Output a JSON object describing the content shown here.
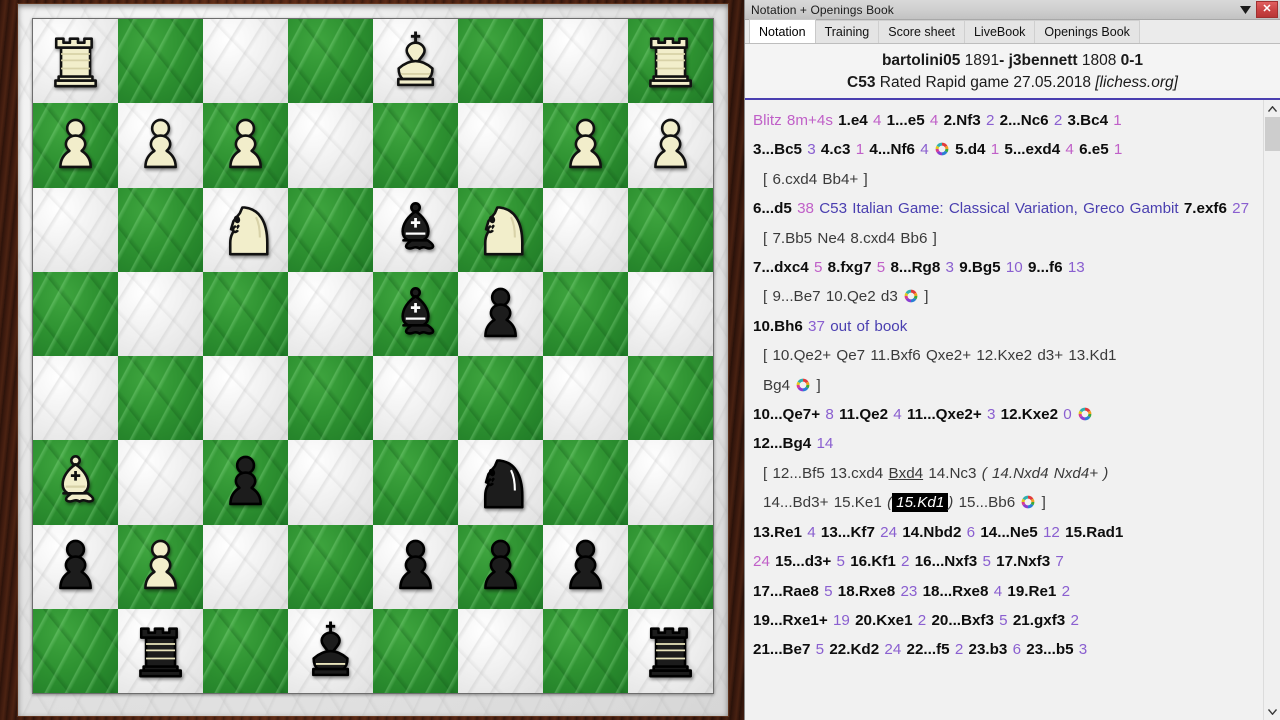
{
  "window": {
    "title": "Notation + Openings Book",
    "minimize_icon": "chevron-down-icon",
    "close_label": "✕"
  },
  "tabs": [
    {
      "label": "Notation",
      "active": true
    },
    {
      "label": "Training",
      "active": false
    },
    {
      "label": "Score sheet",
      "active": false
    },
    {
      "label": "LiveBook",
      "active": false
    },
    {
      "label": "Openings Book",
      "active": false
    }
  ],
  "game_header": {
    "white_player": "bartolini05",
    "white_rating": "1891",
    "dash": "-",
    "black_player": "j3bennett",
    "black_rating": "1808",
    "result": "0-1",
    "eco": "C53",
    "event": "Rated Rapid game",
    "date": "27.05.2018",
    "source": "[lichess.org]"
  },
  "notation": {
    "time_control": "Blitz 8m+4s",
    "opening_name": "C53 Italian Game: Classical Variation, Greco Gambit",
    "out_of_book": "out of book",
    "highlighted_move": "15.Kd1",
    "moves": [
      {
        "san": "1.e4",
        "time": "4"
      },
      {
        "san": "1...e5",
        "time": "4"
      },
      {
        "san": "2.Nf3",
        "time": "2"
      },
      {
        "san": "2...Nc6",
        "time": "2"
      },
      {
        "san": "3.Bc4",
        "time": "1"
      },
      {
        "san": "3...Bc5",
        "time": "3"
      },
      {
        "san": "4.c3",
        "time": "1"
      },
      {
        "san": "4...Nf6",
        "time": "4"
      },
      {
        "san": "5.d4",
        "time": "1"
      },
      {
        "san": "5...exd4",
        "time": "4"
      },
      {
        "san": "6.e5",
        "time": "1"
      },
      {
        "san": "6...d5",
        "time": "38"
      },
      {
        "san": "7.exf6",
        "time": "27"
      },
      {
        "san": "7...dxc4",
        "time": "5"
      },
      {
        "san": "8.fxg7",
        "time": "5"
      },
      {
        "san": "8...Rg8",
        "time": "3"
      },
      {
        "san": "9.Bg5",
        "time": "10"
      },
      {
        "san": "9...f6",
        "time": "13"
      },
      {
        "san": "10.Bh6",
        "time": "37"
      },
      {
        "san": "10...Qe7+",
        "time": "8"
      },
      {
        "san": "11.Qe2",
        "time": "4"
      },
      {
        "san": "11...Qxe2+",
        "time": "3"
      },
      {
        "san": "12.Kxe2",
        "time": "0"
      },
      {
        "san": "12...Bg4",
        "time": "14"
      },
      {
        "san": "13.Re1",
        "time": "4"
      },
      {
        "san": "13...Kf7",
        "time": "24"
      },
      {
        "san": "14.Nbd2",
        "time": "6"
      },
      {
        "san": "14...Ne5",
        "time": "12"
      },
      {
        "san": "15.Rad1",
        "time": "24"
      },
      {
        "san": "15...d3+",
        "time": "5"
      },
      {
        "san": "16.Kf1",
        "time": "2"
      },
      {
        "san": "16...Nxf3",
        "time": "5"
      },
      {
        "san": "17.Nxf3",
        "time": "7"
      },
      {
        "san": "17...Rae8",
        "time": "5"
      },
      {
        "san": "18.Rxe8",
        "time": "23"
      },
      {
        "san": "18...Rxe8",
        "time": "4"
      },
      {
        "san": "19.Re1",
        "time": "2"
      },
      {
        "san": "19...Rxe1+",
        "time": "19"
      },
      {
        "san": "20.Kxe1",
        "time": "2"
      },
      {
        "san": "20...Bxf3",
        "time": "5"
      },
      {
        "san": "21.gxf3",
        "time": "2"
      },
      {
        "san": "21...Be7",
        "time": "5"
      },
      {
        "san": "22.Kd2",
        "time": "24"
      },
      {
        "san": "22...f5",
        "time": "2"
      },
      {
        "san": "23.b3",
        "time": "6"
      },
      {
        "san": "23...b5",
        "time": "3"
      }
    ],
    "variations": [
      "[ 6.cxd4  Bb4+ ]",
      "[ 7.Bb5  Ne4  8.cxd4  Bb6 ]",
      "[ 9...Be7  10.Qe2  d3 ]",
      "[ 10.Qe2+  Qe7  11.Bxf6  Qxe2+  12.Kxe2  d3+  13.Kd1  Bg4 ]",
      "[ 12...Bf5  13.cxd4  Bxd4  14.Nc3 ( 14.Nxd4  Nxd4+ ) 14...Bd3+  15.Ke1 ( 15.Kd1 ) 15...Bb6 ]"
    ],
    "scrollbar": {
      "up_icon": "chevron-up-icon",
      "down_icon": "chevron-down-icon"
    }
  },
  "board": {
    "orientation": "white-bottom",
    "light_square_color": "#eeeeee",
    "dark_square_color": "#2e9231",
    "squares": [
      [
        "wR",
        "",
        "",
        "",
        "wK",
        "",
        "",
        "wR"
      ],
      [
        "wP",
        "wP",
        "wP",
        "",
        "",
        "",
        "wP",
        "wP"
      ],
      [
        "",
        "",
        "wN",
        "",
        "bB",
        "wN",
        "",
        ""
      ],
      [
        "",
        "",
        "",
        "",
        "bB",
        "bP",
        "",
        ""
      ],
      [
        "",
        "",
        "",
        "",
        "",
        "",
        "",
        ""
      ],
      [
        "wB",
        "",
        "bP",
        "",
        "",
        "bN",
        "",
        ""
      ],
      [
        "bP",
        "wP",
        "",
        "",
        "bP",
        "bP",
        "bP",
        ""
      ],
      [
        "",
        "bR",
        "",
        "bK",
        "",
        "",
        "",
        "bR"
      ]
    ]
  }
}
